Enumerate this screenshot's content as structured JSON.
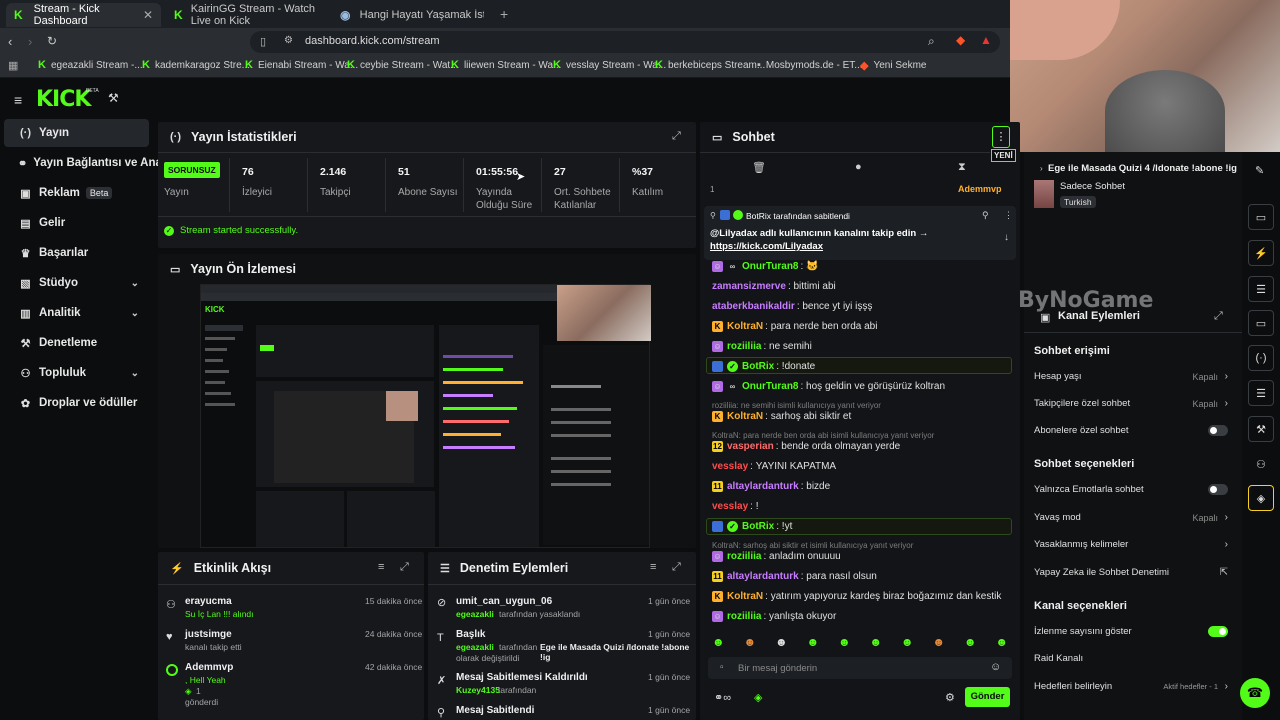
{
  "browser": {
    "tabs": [
      {
        "title": "Stream - Kick Dashboard",
        "active": true
      },
      {
        "title": "KairinGG Stream - Watch Live on Kick",
        "active": false
      },
      {
        "title": "Hangi Hayatı Yaşamak İstersin? - Tie",
        "active": false
      }
    ],
    "url": "dashboard.kick.com/stream",
    "bookmarks": [
      "egeazakli Stream -...",
      "kademkaragoz Stre...",
      "Eienabi Stream - Wa...",
      "ceybie Stream - Wat...",
      "liiewen Stream - Wa...",
      "vesslay Stream - Wa...",
      "berkebiceps Stream...",
      "Mosbymods.de - ET...",
      "Yeni Sekme"
    ]
  },
  "header": {
    "logo": "KICK",
    "beta": "BETA"
  },
  "sidebar": {
    "items": [
      {
        "label": "Yayın",
        "icon": "broadcast-icon"
      },
      {
        "label": "Yayın Bağlantısı ve Anahta",
        "icon": "link-icon"
      },
      {
        "label": "Reklam",
        "badge": "Beta",
        "icon": "ad-icon"
      },
      {
        "label": "Gelir",
        "icon": "money-icon"
      },
      {
        "label": "Başarılar",
        "icon": "trophy-icon"
      },
      {
        "label": "Stüdyo",
        "icon": "studio-icon"
      },
      {
        "label": "Analitik",
        "icon": "chart-icon"
      },
      {
        "label": "Denetleme",
        "icon": "hammer-icon"
      },
      {
        "label": "Topluluk",
        "icon": "community-icon"
      },
      {
        "label": "Droplar ve ödüller",
        "icon": "gift-icon"
      }
    ]
  },
  "stats": {
    "title": "Yayın İstatistikleri",
    "status_badge": "SORUNSUZ",
    "status_label": "Yayın",
    "items": [
      {
        "value": "76",
        "label": "İzleyici"
      },
      {
        "value": "2.146",
        "label": "Takipçi"
      },
      {
        "value": "51",
        "label": "Abone Sayısı"
      },
      {
        "value": "01:55:56",
        "label": "Yayında Olduğu Süre"
      },
      {
        "value": "27",
        "label": "Ort. Sohbete Katılanlar"
      },
      {
        "value": "%37",
        "label": "Katılım"
      }
    ],
    "success": "Stream started successfully."
  },
  "preview": {
    "title": "Yayın Ön İzlemesi"
  },
  "activity": {
    "title": "Etkinlik Akışı",
    "items": [
      {
        "name": "erayucma",
        "sub": "Su İç Lan !!! alındı",
        "time": "15 dakika önce"
      },
      {
        "name": "justsimge",
        "sub": "kanalı takip etti",
        "time": "24 dakika önce"
      },
      {
        "name": "Ademmvp",
        "sub": ", Hell Yeah",
        "count": "1",
        "sub2": "gönderdi",
        "time": "42 dakika önce"
      }
    ]
  },
  "moderation": {
    "title": "Denetim Eylemleri",
    "items": [
      {
        "name": "umit_can_uygun_06",
        "user": "egeazakli",
        "sub": "tarafından yasaklandı",
        "time": "1 gün önce"
      },
      {
        "name": "Başlık",
        "user": "egeazakli",
        "sub": "tarafından",
        "detail": "Ege ile Masada Quizi /ldonate !abone !ig",
        "sub2": "olarak değiştirildi",
        "time": "1 gün önce"
      },
      {
        "name": "Mesaj Sabitlemesi Kaldırıldı",
        "user": "Kuzey4135",
        "sub": "tarafından",
        "time": "1 gün önce"
      },
      {
        "name": "Mesaj Sabitlendi",
        "time": "1 gün önce"
      }
    ]
  },
  "chat": {
    "title": "Sohbet",
    "new_badge": "YENİ",
    "pinned_by": "BotRix tarafından sabitlendi",
    "pinned_text": "@Lilyadax adlı kullanıcının kanalını takip edin →",
    "pinned_link": "https://kick.com/Lilyadax",
    "top_user": "Ademmvp",
    "top_count": "1",
    "messages": [
      {
        "user": "OnurTuran8",
        "text": "",
        "color": "#53fc18"
      },
      {
        "user": "zamansizmerve",
        "text": "bittimi abi",
        "color": "#c77dff"
      },
      {
        "user": "ataberkbanikaldir",
        "text": "bence yt iyi işşş",
        "color": "#c77dff"
      },
      {
        "user": "KoltraN",
        "text": "para nerde ben orda abi",
        "color": "#ffb02e"
      },
      {
        "user": "roziiliia",
        "text": "ne semihi",
        "color": "#53fc18"
      },
      {
        "user": "BotRix",
        "text": "!donate",
        "color": "#53fc18"
      },
      {
        "user": "OnurTuran8",
        "text": "hoş geldin ve görüşürüz koltran",
        "color": "#53fc18"
      },
      {
        "reply": "roziiliia: ne semihi isimli kullanıcıya yanıt veriyor"
      },
      {
        "user": "KoltraN",
        "text": "sarhoş abi siktir et",
        "color": "#ffb02e"
      },
      {
        "reply": "KoltraN: para nerde ben orda abi isimli kullanıcıya yanıt veriyor"
      },
      {
        "user": "vasperian",
        "text": "bende orda olmayan yerde",
        "color": "#ff6b6b"
      },
      {
        "user": "vesslay",
        "text": "YAYINI KAPATMA",
        "color": "#ff4d4d"
      },
      {
        "user": "altaylardanturk",
        "text": "bizde",
        "color": "#c77dff"
      },
      {
        "user": "vesslay",
        "text": "!",
        "color": "#ff4d4d"
      },
      {
        "user": "BotRix",
        "text": "!yt",
        "color": "#53fc18"
      },
      {
        "reply": "KoltraN: sarhoş abi siktir et isimli kullanıcıya yanıt veriyor"
      },
      {
        "user": "roziiliia",
        "text": "anladım onuuuu",
        "color": "#53fc18"
      },
      {
        "user": "altaylardanturk",
        "text": "para nasıl olsun",
        "color": "#c77dff"
      },
      {
        "user": "KoltraN",
        "text": "yatırım yapıyoruz kardeş biraz boğazımız dan kestik",
        "color": "#ffb02e"
      },
      {
        "user": "roziiliia",
        "text": "yanlışta okuyor",
        "color": "#53fc18"
      }
    ],
    "input_placeholder": "Bir mesaj gönderin",
    "send_label": "Gönder"
  },
  "right_panel": {
    "stream_title": "Ege ile Masada Quizi 4 /ldonate !abone !ig",
    "chat_mode": "Sadece Sohbet",
    "language": "Turkish",
    "watermark": "ByNoGame",
    "channel_actions_title": "Kanal Eylemleri",
    "sections": {
      "chat_access": "Sohbet erişimi",
      "chat_options": "Sohbet seçenekleri",
      "channel_options": "Kanal seçenekleri"
    },
    "rows": {
      "account_age": {
        "label": "Hesap yaşı",
        "value": "Kapalı"
      },
      "follower_chat": {
        "label": "Takipçilere özel sohbet",
        "value": "Kapalı"
      },
      "sub_chat": {
        "label": "Abonelere özel sohbet"
      },
      "emote_only": {
        "label": "Yalnızca Emotlarla sohbet"
      },
      "slow_mode": {
        "label": "Yavaş mod",
        "value": "Kapalı"
      },
      "banned_words": {
        "label": "Yasaklanmış kelimeler"
      },
      "ai_mod": {
        "label": "Yapay Zeka ile Sohbet Denetimi"
      },
      "viewer_count": {
        "label": "İzlenme sayısını göster"
      },
      "raid": {
        "label": "Raid Kanalı"
      },
      "goals": {
        "label": "Hedefleri belirleyin",
        "value": "Aktif hedefler - 1"
      }
    }
  },
  "colors": {
    "accent": "#53fc18",
    "bg": "#0b0d0e",
    "panel": "#16181c"
  }
}
